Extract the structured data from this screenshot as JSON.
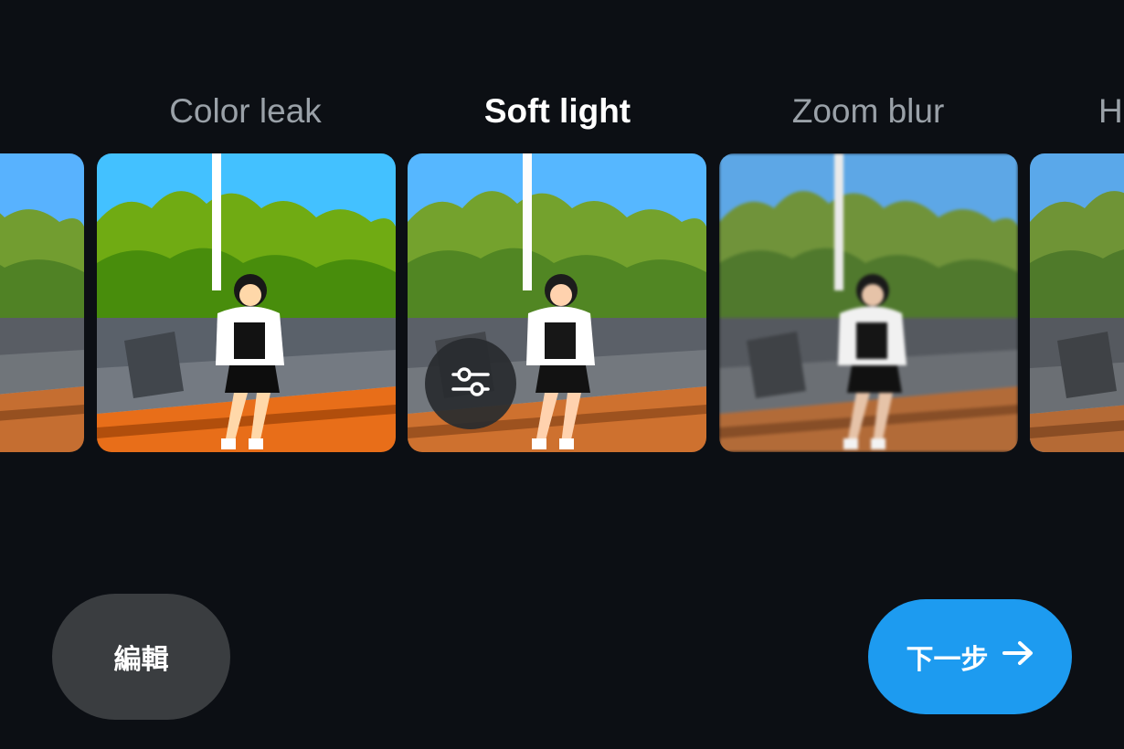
{
  "filters": [
    {
      "label": "",
      "selected": false
    },
    {
      "label": "Color leak",
      "selected": false
    },
    {
      "label": "Soft light",
      "selected": true
    },
    {
      "label": "Zoom blur",
      "selected": false
    },
    {
      "label": "H",
      "selected": false
    }
  ],
  "overlay": {
    "icon": "sliders-icon"
  },
  "actions": {
    "edit_label": "編輯",
    "next_label": "下一步",
    "next_icon": "arrow-right-icon"
  },
  "colors": {
    "background": "#0c0f14",
    "accent": "#1d9bf0",
    "edit_button": "#3a3d40",
    "label_inactive": "#9aa1a8",
    "label_active": "#ffffff"
  }
}
